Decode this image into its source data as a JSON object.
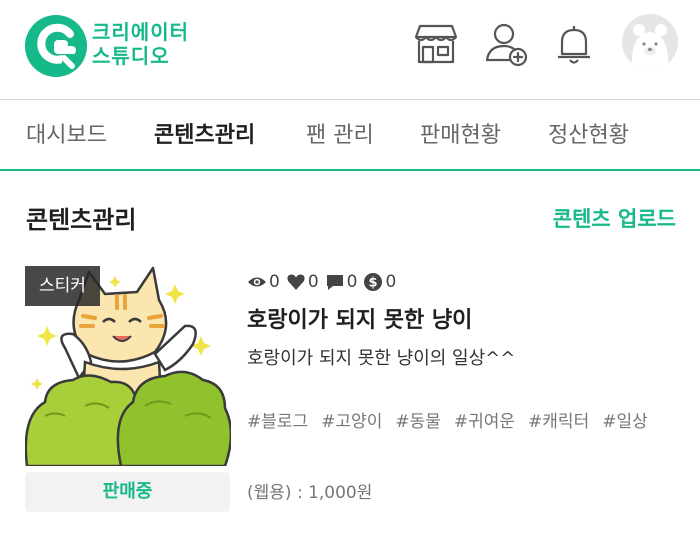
{
  "header": {
    "logo_line1": "크리에이터",
    "logo_line2": "스튜디오",
    "icons": [
      "store-icon",
      "add-user-icon",
      "bell-icon",
      "avatar-bear"
    ]
  },
  "tabs": [
    {
      "label": "대시보드",
      "active": false
    },
    {
      "label": "콘텐츠관리",
      "active": true
    },
    {
      "label": "팬 관리",
      "active": false
    },
    {
      "label": "판매현황",
      "active": false
    },
    {
      "label": "정산현황",
      "active": false
    }
  ],
  "section": {
    "title": "콘텐츠관리",
    "upload_label": "콘텐츠 업로드"
  },
  "item": {
    "badge": "스티커",
    "stats": {
      "views": "0",
      "likes": "0",
      "comments": "0",
      "sales": "0"
    },
    "title": "호랑이가 되지 못한 냥이",
    "description": "호랑이가 되지 못한 냥이의 일상^^",
    "tags": [
      "#블로그",
      "#고양이",
      "#동물",
      "#귀여운",
      "#캐릭터",
      "#일상"
    ],
    "price": "(웹용) : 1,000원",
    "status": "판매중"
  },
  "colors": {
    "accent": "#16b98a",
    "badge_bg": "#333333"
  }
}
